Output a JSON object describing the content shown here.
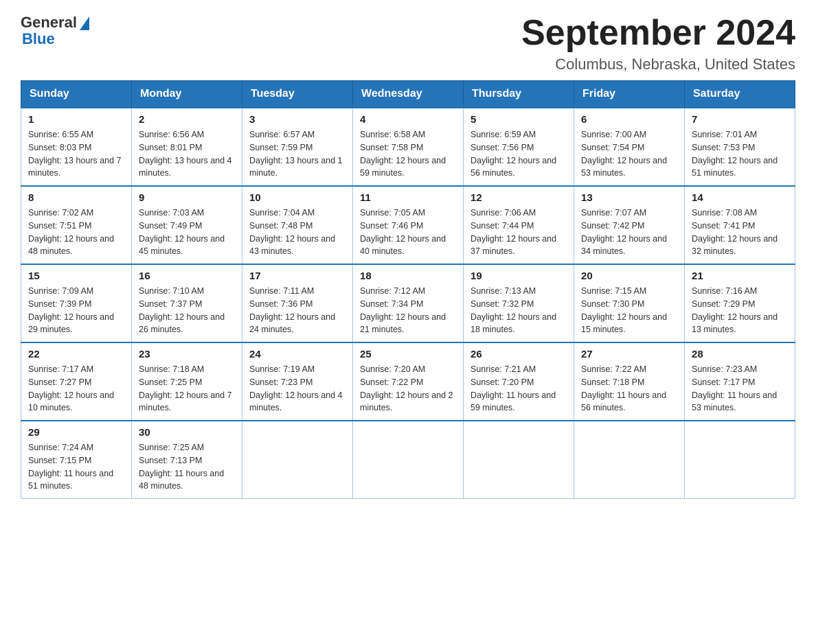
{
  "header": {
    "logo_general": "General",
    "logo_blue": "Blue",
    "month_title": "September 2024",
    "location": "Columbus, Nebraska, United States"
  },
  "days_of_week": [
    "Sunday",
    "Monday",
    "Tuesday",
    "Wednesday",
    "Thursday",
    "Friday",
    "Saturday"
  ],
  "weeks": [
    [
      {
        "date": "1",
        "sunrise": "6:55 AM",
        "sunset": "8:03 PM",
        "daylight": "13 hours and 7 minutes."
      },
      {
        "date": "2",
        "sunrise": "6:56 AM",
        "sunset": "8:01 PM",
        "daylight": "13 hours and 4 minutes."
      },
      {
        "date": "3",
        "sunrise": "6:57 AM",
        "sunset": "7:59 PM",
        "daylight": "13 hours and 1 minute."
      },
      {
        "date": "4",
        "sunrise": "6:58 AM",
        "sunset": "7:58 PM",
        "daylight": "12 hours and 59 minutes."
      },
      {
        "date": "5",
        "sunrise": "6:59 AM",
        "sunset": "7:56 PM",
        "daylight": "12 hours and 56 minutes."
      },
      {
        "date": "6",
        "sunrise": "7:00 AM",
        "sunset": "7:54 PM",
        "daylight": "12 hours and 53 minutes."
      },
      {
        "date": "7",
        "sunrise": "7:01 AM",
        "sunset": "7:53 PM",
        "daylight": "12 hours and 51 minutes."
      }
    ],
    [
      {
        "date": "8",
        "sunrise": "7:02 AM",
        "sunset": "7:51 PM",
        "daylight": "12 hours and 48 minutes."
      },
      {
        "date": "9",
        "sunrise": "7:03 AM",
        "sunset": "7:49 PM",
        "daylight": "12 hours and 45 minutes."
      },
      {
        "date": "10",
        "sunrise": "7:04 AM",
        "sunset": "7:48 PM",
        "daylight": "12 hours and 43 minutes."
      },
      {
        "date": "11",
        "sunrise": "7:05 AM",
        "sunset": "7:46 PM",
        "daylight": "12 hours and 40 minutes."
      },
      {
        "date": "12",
        "sunrise": "7:06 AM",
        "sunset": "7:44 PM",
        "daylight": "12 hours and 37 minutes."
      },
      {
        "date": "13",
        "sunrise": "7:07 AM",
        "sunset": "7:42 PM",
        "daylight": "12 hours and 34 minutes."
      },
      {
        "date": "14",
        "sunrise": "7:08 AM",
        "sunset": "7:41 PM",
        "daylight": "12 hours and 32 minutes."
      }
    ],
    [
      {
        "date": "15",
        "sunrise": "7:09 AM",
        "sunset": "7:39 PM",
        "daylight": "12 hours and 29 minutes."
      },
      {
        "date": "16",
        "sunrise": "7:10 AM",
        "sunset": "7:37 PM",
        "daylight": "12 hours and 26 minutes."
      },
      {
        "date": "17",
        "sunrise": "7:11 AM",
        "sunset": "7:36 PM",
        "daylight": "12 hours and 24 minutes."
      },
      {
        "date": "18",
        "sunrise": "7:12 AM",
        "sunset": "7:34 PM",
        "daylight": "12 hours and 21 minutes."
      },
      {
        "date": "19",
        "sunrise": "7:13 AM",
        "sunset": "7:32 PM",
        "daylight": "12 hours and 18 minutes."
      },
      {
        "date": "20",
        "sunrise": "7:15 AM",
        "sunset": "7:30 PM",
        "daylight": "12 hours and 15 minutes."
      },
      {
        "date": "21",
        "sunrise": "7:16 AM",
        "sunset": "7:29 PM",
        "daylight": "12 hours and 13 minutes."
      }
    ],
    [
      {
        "date": "22",
        "sunrise": "7:17 AM",
        "sunset": "7:27 PM",
        "daylight": "12 hours and 10 minutes."
      },
      {
        "date": "23",
        "sunrise": "7:18 AM",
        "sunset": "7:25 PM",
        "daylight": "12 hours and 7 minutes."
      },
      {
        "date": "24",
        "sunrise": "7:19 AM",
        "sunset": "7:23 PM",
        "daylight": "12 hours and 4 minutes."
      },
      {
        "date": "25",
        "sunrise": "7:20 AM",
        "sunset": "7:22 PM",
        "daylight": "12 hours and 2 minutes."
      },
      {
        "date": "26",
        "sunrise": "7:21 AM",
        "sunset": "7:20 PM",
        "daylight": "11 hours and 59 minutes."
      },
      {
        "date": "27",
        "sunrise": "7:22 AM",
        "sunset": "7:18 PM",
        "daylight": "11 hours and 56 minutes."
      },
      {
        "date": "28",
        "sunrise": "7:23 AM",
        "sunset": "7:17 PM",
        "daylight": "11 hours and 53 minutes."
      }
    ],
    [
      {
        "date": "29",
        "sunrise": "7:24 AM",
        "sunset": "7:15 PM",
        "daylight": "11 hours and 51 minutes."
      },
      {
        "date": "30",
        "sunrise": "7:25 AM",
        "sunset": "7:13 PM",
        "daylight": "11 hours and 48 minutes."
      },
      null,
      null,
      null,
      null,
      null
    ]
  ]
}
